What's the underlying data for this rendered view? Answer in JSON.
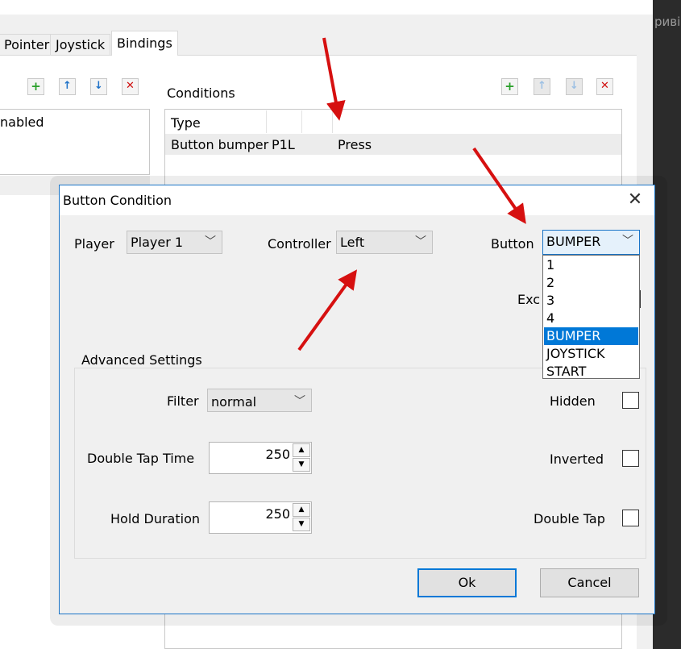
{
  "background_window": {
    "tabs": [
      {
        "label": "Pointer"
      },
      {
        "label": "Joystick"
      },
      {
        "label": "Bindings",
        "active": true
      }
    ],
    "left_list": {
      "first_item_partial": "nabled"
    },
    "conditions": {
      "label": "Conditions",
      "columns": [
        "Type",
        "",
        "",
        ""
      ],
      "rows": [
        [
          "Button bumper",
          "P1L",
          "",
          "Press"
        ]
      ]
    },
    "toolbar_icons": [
      "add-icon",
      "move-up-icon",
      "move-down-icon",
      "delete-icon"
    ],
    "right_edge_text": "риві"
  },
  "dialog": {
    "title": "Button Condition",
    "close_glyph": "✕",
    "player": {
      "label": "Player",
      "value": "Player 1"
    },
    "controller": {
      "label": "Controller",
      "value": "Left"
    },
    "button": {
      "label": "Button",
      "value": "BUMPER",
      "options": [
        "1",
        "2",
        "3",
        "4",
        "BUMPER",
        "JOYSTICK",
        "START"
      ],
      "selected": "BUMPER"
    },
    "partial_label": "Exc",
    "advanced": {
      "title": "Advanced Settings",
      "filter": {
        "label": "Filter",
        "value": "normal"
      },
      "double_tap_time": {
        "label": "Double Tap Time",
        "value": "250"
      },
      "hold_duration": {
        "label": "Hold Duration",
        "value": "250"
      },
      "hidden": {
        "label": "Hidden",
        "checked": false
      },
      "inverted": {
        "label": "Inverted",
        "checked": false
      },
      "double_tap": {
        "label": "Double Tap",
        "checked": false
      }
    },
    "ok_label": "Ok",
    "cancel_label": "Cancel"
  },
  "colors": {
    "accent": "#0078d7",
    "annotation_red": "#d61010",
    "dialog_bg": "#f0f0f0"
  }
}
